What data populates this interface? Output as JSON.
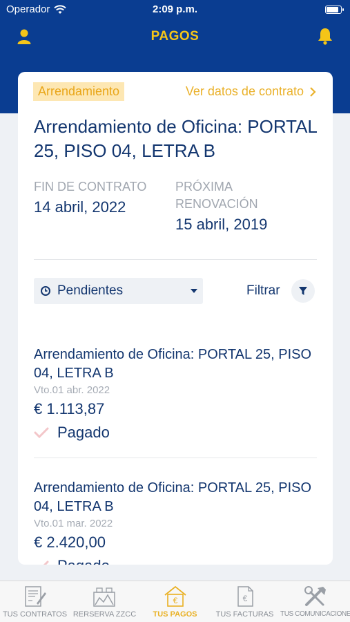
{
  "status_bar": {
    "carrier": "Operador",
    "time": "2:09 p.m.",
    "battery_level": 0.9
  },
  "header": {
    "title": "PAGOS",
    "user_icon": "user-icon",
    "bell_icon": "bell-icon"
  },
  "contract": {
    "tag": "Arrendamiento",
    "link_label": "Ver datos de contrato",
    "title": "Arrendamiento de Oficina: PORTAL 25, PISO 04, LETRA B",
    "end_label": "FIN DE CONTRATO",
    "end_value": "14 abril, 2022",
    "renewal_label": "PRÓXIMA RENOVACIÓN",
    "renewal_value": "15 abril, 2019"
  },
  "filter": {
    "selected": "Pendientes",
    "filter_label": "Filtrar"
  },
  "payments": [
    {
      "title": "Arrendamiento de Oficina: PORTAL 25, PISO 04, LETRA B",
      "due": "Vto.01 abr. 2022",
      "amount": "€ 1.113,87",
      "status": "Pagado"
    },
    {
      "title": "Arrendamiento de Oficina: PORTAL 25, PISO 04, LETRA B",
      "due": "Vto.01 mar. 2022",
      "amount": "€ 2.420,00",
      "status": "Pagado"
    }
  ],
  "tabs": [
    {
      "label": "TUS CONTRATOS",
      "icon": "contract-icon"
    },
    {
      "label": "RERSERVA ZZCC",
      "icon": "reservation-icon"
    },
    {
      "label": "TUS PAGOS",
      "icon": "payments-icon",
      "active": true
    },
    {
      "label": "TUS FACTURAS",
      "icon": "invoice-icon"
    },
    {
      "label": "TUS COMUNICACIONES",
      "icon": "tools-icon"
    }
  ],
  "colors": {
    "primary": "#0a3d91",
    "accent": "#f5c518",
    "text": "#13366f"
  }
}
